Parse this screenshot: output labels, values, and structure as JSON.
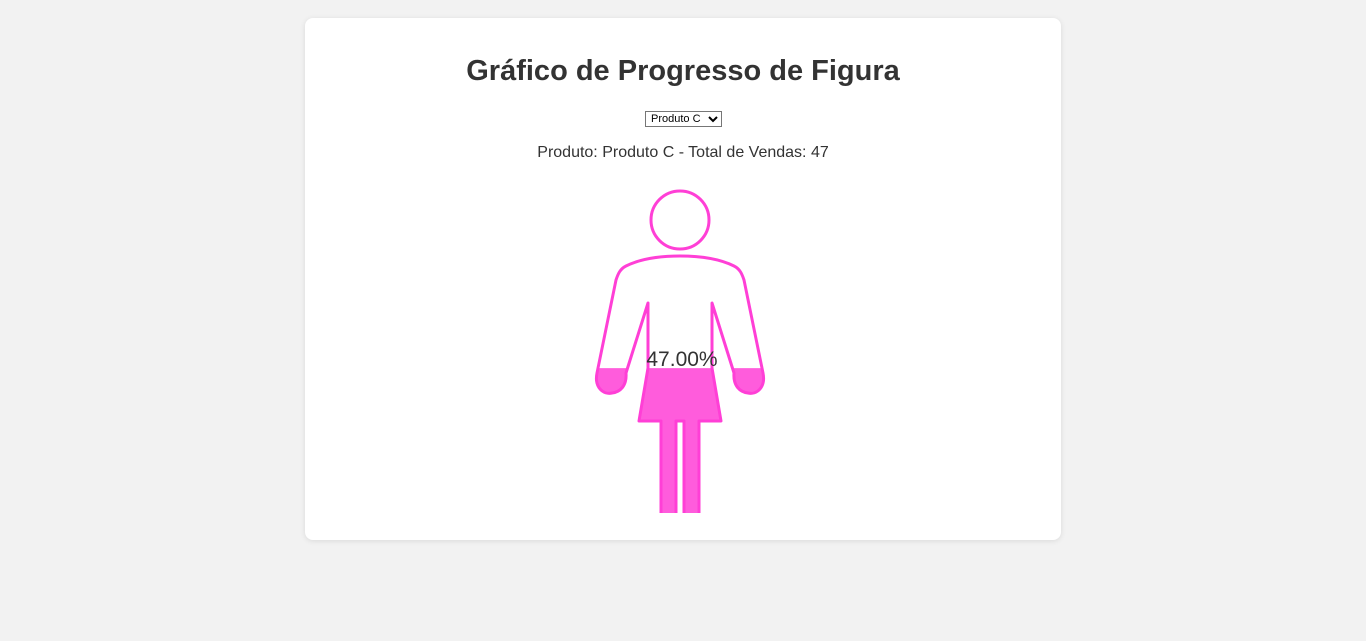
{
  "title": "Gráfico de Progresso de Figura",
  "selector": {
    "selected": "Produto C"
  },
  "info": {
    "prefix": "Produto: ",
    "product": "Produto C",
    "separator": " - Total de Vendas: ",
    "total": "47"
  },
  "chart_data": {
    "type": "pictogram-progress",
    "figure": "woman",
    "product": "Produto C",
    "value": 47,
    "max": 100,
    "percent": 0.47,
    "label": "47.00%",
    "fill_color": "#ff5cdc",
    "outline_color": "#ff3fd6"
  },
  "colors": {
    "background": "#f2f2f2",
    "card": "#ffffff",
    "text": "#333333",
    "accent": "#ff5cdc"
  }
}
